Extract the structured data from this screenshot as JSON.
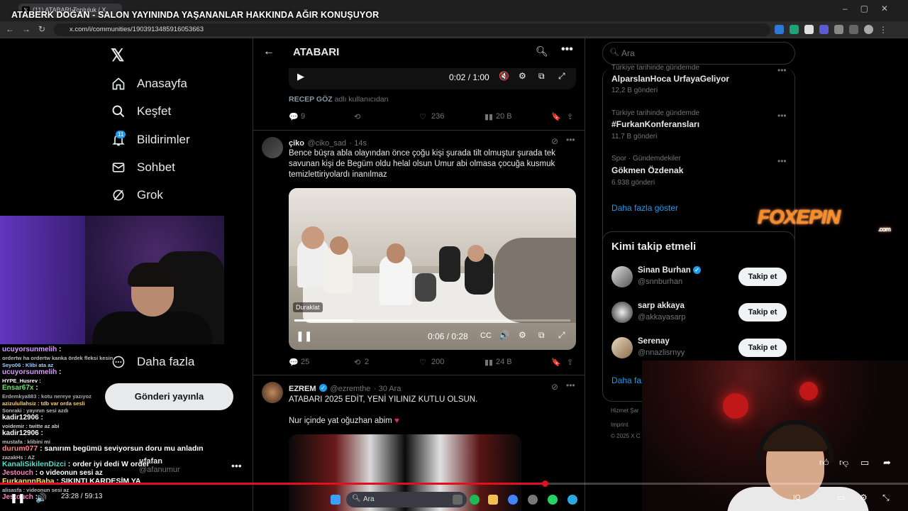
{
  "browser": {
    "tab_title": "(11) ATABARI Topluluk / X",
    "stream_title": "ATABERK DOĞAN - SALON YAYININDA YAŞANANLAR HAKKINDA AĞIR KONUŞUYOR",
    "url": "x.com/i/communities/1903913485916053663"
  },
  "nav": {
    "items": [
      {
        "label": "Anasayfa",
        "icon": "home-icon"
      },
      {
        "label": "Keşfet",
        "icon": "search-icon"
      },
      {
        "label": "Bildirimler",
        "icon": "bell-icon",
        "badge": "11"
      },
      {
        "label": "Sohbet",
        "icon": "mail-icon"
      },
      {
        "label": "Grok",
        "icon": "grok-icon"
      }
    ],
    "more_label": "Daha fazla",
    "post_button": "Gönderi yayınla",
    "account_name": "ufafan",
    "account_handle": "@afanumur"
  },
  "main": {
    "title": "ATABARI",
    "top_video": {
      "time": "0:02 / 1:00"
    },
    "repost_note": {
      "user": "RECEP GÖZ",
      "suffix": "adlı kullanıcıdan"
    },
    "first_actions": {
      "replies": "9",
      "reposts": "",
      "likes": "236",
      "views": "20 B"
    },
    "tweets": [
      {
        "name": "çiko",
        "handle": "@ciko_sad",
        "time": "· 14s",
        "text": "Bence büşra abla olayından önce çoğu kişi şurada tilt olmuştur şurada tek savunan kişi de Begüm oldu helal olsun Umur abi olmasa çocuğa kusmuk temizlettiriyolardı inanılmaz",
        "video_tooltip": "Duraklat",
        "video_time": "0:06 / 0:28",
        "video_progress": 0.21,
        "replies": "25",
        "reposts": "2",
        "likes": "200",
        "views": "24 B"
      },
      {
        "name": "EZREM",
        "handle": "@ezremthe",
        "time": "· 30 Ara",
        "text1": "ATABARI 2025 EDİT, YENİ YILINIZ KUTLU OLSUN.",
        "text2": "Nur içinde yat oğuzhan abim",
        "heart": "♥"
      }
    ]
  },
  "right": {
    "search_placeholder": "Ara",
    "trends": [
      {
        "meta": "Türkiye tarihinde gündemde",
        "name": "AlparslanHoca UrfayaGeliyor",
        "count": "12,2 B gönderi"
      },
      {
        "meta": "Türkiye tarihinde gündemde",
        "name": "#FurkanKonferansları",
        "count": "11,7 B gönderi"
      },
      {
        "meta": "Spor · Gündemdekiler",
        "name": "Gökmen Özdenak",
        "count": "6.938 gönderi"
      }
    ],
    "show_more": "Daha fazla göster",
    "who_to_follow": {
      "title": "Kimi takip etmeli",
      "users": [
        {
          "name": "Sinan Burhan",
          "handle": "@snnburhan",
          "verified": true,
          "button": "Takip et"
        },
        {
          "name": "sarp akkaya",
          "handle": "@akkayasarp",
          "verified": false,
          "button": "Takip et"
        },
        {
          "name": "Serenay",
          "handle": "@nnazlisrnyy",
          "verified": false,
          "button": "Takip et"
        }
      ],
      "more": "Daha faz"
    },
    "footer": [
      "Hizmet Şar",
      "Imprint",
      "© 2025 X C"
    ]
  },
  "overlay": {
    "sponsor": "FOXEPIN",
    "sponsor_sub": ".com"
  },
  "chat": [
    {
      "user": "ucuyorsunmelih",
      "msg": ":",
      "color": "#d89bff"
    },
    {
      "user": "",
      "msg": "ordertw ha ordertw kanka ördek fleksi kesin",
      "color": "#bbbbbb",
      "small": true
    },
    {
      "user": "",
      "msg": "Seyo06 : Klibi ata az",
      "color": "#9fd0ff",
      "small": true
    },
    {
      "user": "ucuyorsunmelih",
      "msg": ":",
      "color": "#d89bff"
    },
    {
      "user": "HYPE_Husrev",
      "msg": ":",
      "color": "#ffffff",
      "small": true
    },
    {
      "user": "Ensar67x",
      "msg": ":",
      "color": "#6fe06f"
    },
    {
      "user": "",
      "msg": "Erdemkya883 : kotu nereye yazıyoz",
      "color": "#aaaaaa",
      "small": true
    },
    {
      "user": "",
      "msg": "azizulullahsiz : tdb var orda sesli",
      "color": "#ffd070",
      "small": true
    },
    {
      "user": "",
      "msg": "Sonraki : yayının sesi azdı",
      "color": "#bbbbbb",
      "small": true
    },
    {
      "user": "kadir12906",
      "msg": ":",
      "color": "#ffffff"
    },
    {
      "user": "",
      "msg": "voidemir : twitte az abi",
      "color": "#cccccc",
      "small": true
    },
    {
      "user": "kadir12906",
      "msg": ":",
      "color": "#ffffff"
    },
    {
      "user": "",
      "msg": "mustafa : klibini mi",
      "color": "#bbbbbb",
      "small": true
    },
    {
      "user": "durum077",
      "msg": ": sanırım begümü seviyorsun doru mu anladın",
      "color": "#ff8080",
      "big": true
    },
    {
      "user": "",
      "msg": "zazakHs : AZ",
      "color": "#bbbbbb",
      "small": true
    },
    {
      "user": "KanaliSikilenDizci",
      "msg": ": order iyi dedi W order",
      "color": "#4ee0d0",
      "big": true
    },
    {
      "user": "Jestouch",
      "msg": ": o videonun sesi az",
      "color": "#ff80c0"
    },
    {
      "user": "FurkannnBaba",
      "msg": ": SIKINTI KARDESİM YA",
      "color": "#ffe060",
      "big": true
    },
    {
      "user": "",
      "msg": "alisasfa : videonun sesi az",
      "color": "#bbbbbb",
      "small": true
    },
    {
      "user": "Jestouch",
      "msg": ":",
      "color": "#ff80c0"
    }
  ],
  "player": {
    "timecode": "23:28 / 59:13",
    "progress": 0.6,
    "taskbar_search": "Ara"
  }
}
